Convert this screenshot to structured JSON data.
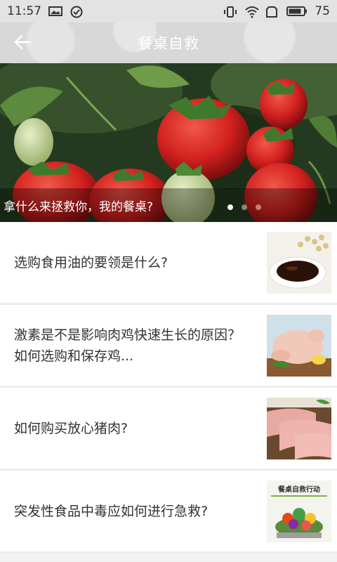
{
  "status_bar": {
    "time": "11:57",
    "battery_level": "75",
    "icons": [
      "image-icon",
      "check-circle-icon",
      "vibrate-icon",
      "wifi-icon",
      "sim-icon",
      "battery-icon"
    ]
  },
  "header": {
    "title": "餐桌自救",
    "back_icon": "back-arrow-icon"
  },
  "banner": {
    "caption": "拿什么来拯救你，我的餐桌?",
    "page_count": 3,
    "active_page": 1
  },
  "articles": [
    {
      "title": "选购食用油的要领是什么?",
      "thumb_icon": "soy-sauce-thumbnail"
    },
    {
      "title": "激素是不是影响肉鸡快速生长的原因？如何选购和保存鸡...",
      "thumb_icon": "raw-chicken-thumbnail"
    },
    {
      "title": "如何购买放心猪肉?",
      "thumb_icon": "pork-chop-thumbnail"
    },
    {
      "title": "突发性食品中毒应如何进行急救?",
      "thumb_icon": "campaign-poster-thumbnail",
      "thumb_text": "餐桌自救行动"
    }
  ],
  "colors": {
    "header_bg": "#d8d8d8",
    "status_bg": "#e3e3e3",
    "text_primary": "#333333",
    "divider": "#ececec"
  }
}
